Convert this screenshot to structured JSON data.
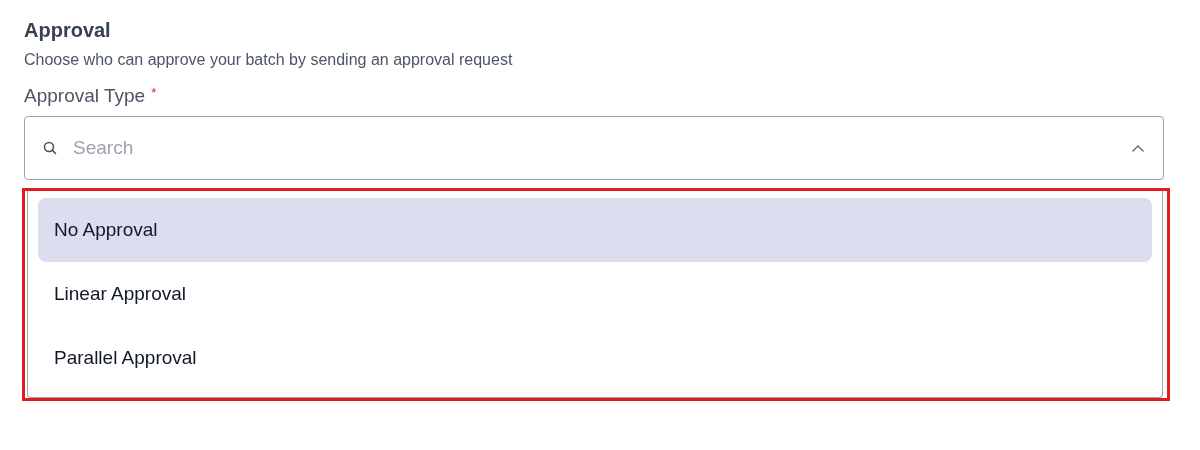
{
  "section": {
    "title": "Approval",
    "description": "Choose who can approve your batch by sending an approval request"
  },
  "field": {
    "label": "Approval Type",
    "required_mark": "*",
    "placeholder": "Search",
    "expanded": true,
    "options": [
      {
        "label": "No Approval",
        "selected": true
      },
      {
        "label": "Linear Approval",
        "selected": false
      },
      {
        "label": "Parallel Approval",
        "selected": false
      }
    ]
  }
}
